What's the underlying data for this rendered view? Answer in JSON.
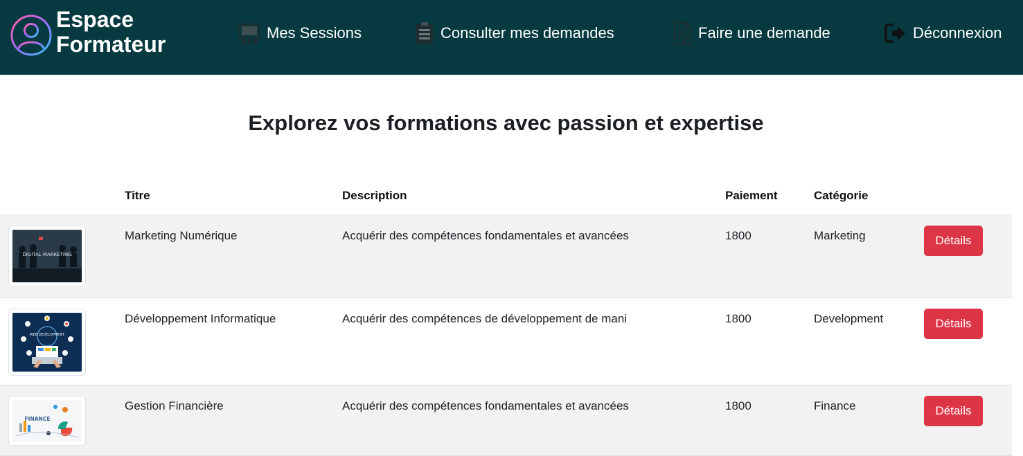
{
  "brand": {
    "line1": "Espace",
    "line2": "Formateur"
  },
  "nav": {
    "items": [
      {
        "label": "Mes Sessions",
        "icon": "presentation-icon"
      },
      {
        "label": "Consulter mes demandes",
        "icon": "clipboard-list-icon"
      },
      {
        "label": "Faire une demande",
        "icon": "document-edit-icon"
      },
      {
        "label": "Déconnexion",
        "icon": "sign-out-icon"
      }
    ]
  },
  "heading": "Explorez vos formations avec passion et expertise",
  "table": {
    "headers": [
      "",
      "Titre",
      "Description",
      "Paiement",
      "Catégorie",
      ""
    ],
    "rows": [
      {
        "title": "Marketing Numérique",
        "description": "Acquérir des compétences fondamentales et avancées",
        "payment": "1800",
        "category": "Marketing",
        "thumb_text": "DIGITAL MARKETING",
        "action": "Détails"
      },
      {
        "title": "Développement Informatique",
        "description": "Acquérir des compétences de développement de mani",
        "payment": "1800",
        "category": "Development",
        "thumb_text": "WEB DEVELOPMENT",
        "action": "Détails"
      },
      {
        "title": "Gestion Financière",
        "description": "Acquérir des compétences fondamentales et avancées",
        "payment": "1800",
        "category": "Finance",
        "thumb_text": "FINANCE",
        "action": "Détails"
      }
    ]
  },
  "colors": {
    "navbar": "#063a40",
    "button": "#dc3545",
    "stripe": "#f2f2f2"
  }
}
